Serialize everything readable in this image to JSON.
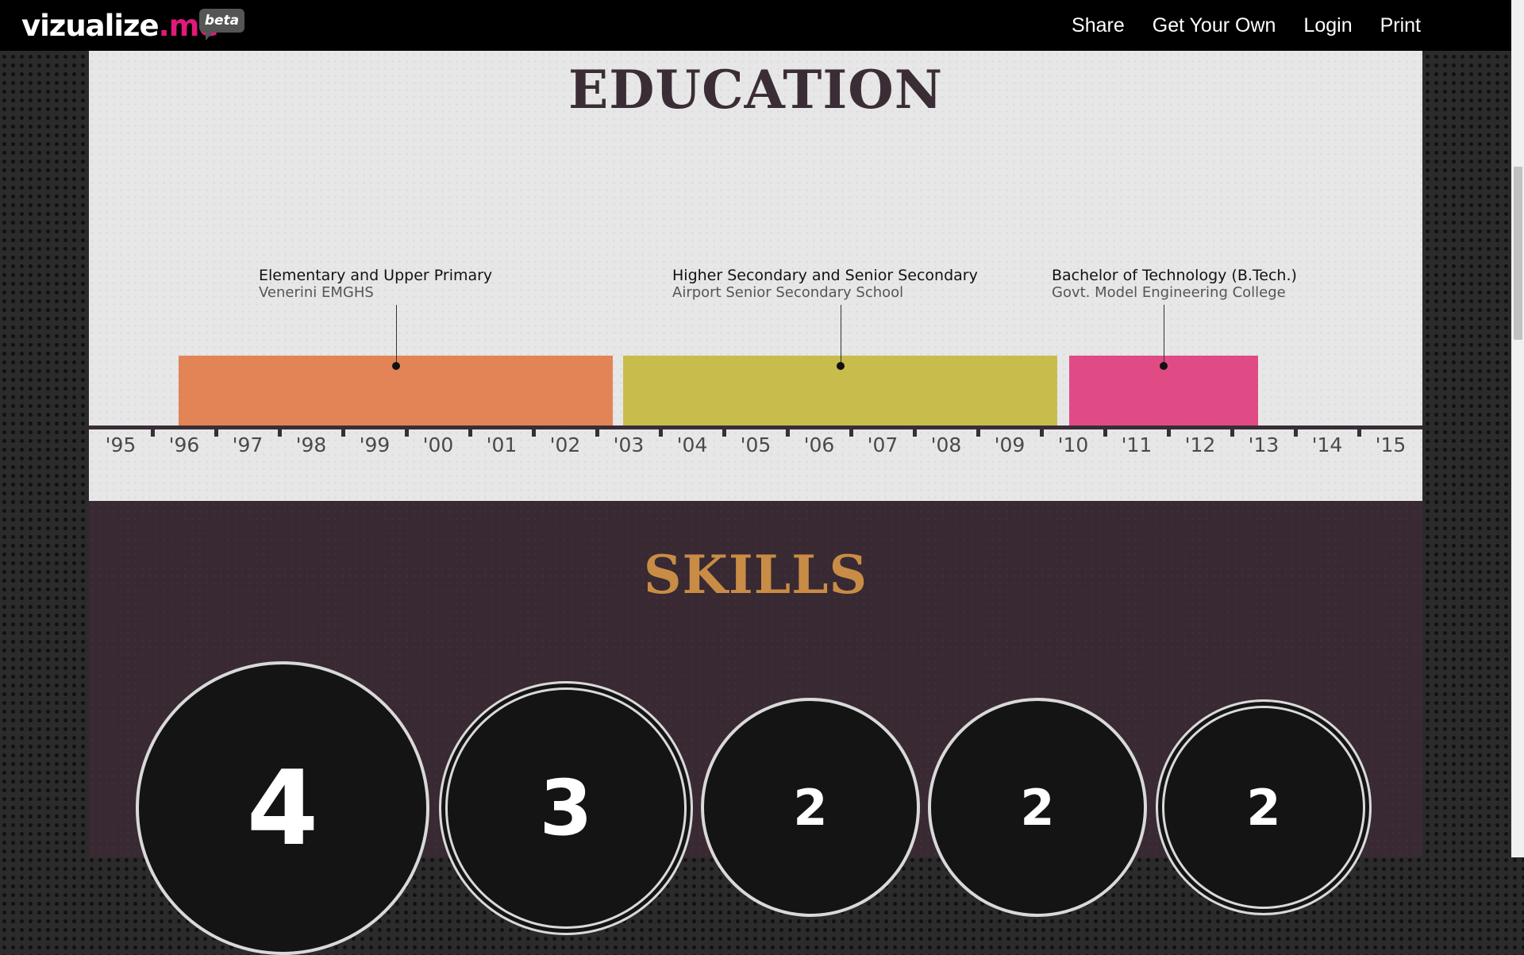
{
  "topbar": {
    "logo_main": "vizualize",
    "logo_accent": ".me",
    "beta": "beta",
    "nav": [
      "Share",
      "Get Your Own",
      "Login",
      "Print"
    ]
  },
  "education": {
    "title": "EDUCATION",
    "years": [
      "'95",
      "'96",
      "'97",
      "'98",
      "'99",
      "'00",
      "'01",
      "'02",
      "'03",
      "'04",
      "'05",
      "'06",
      "'07",
      "'08",
      "'09",
      "'10",
      "'11",
      "'12",
      "'13",
      "'14",
      "'15"
    ],
    "entries": [
      {
        "degree": "Elementary and Upper Primary",
        "institution": "Venerini EMGHS",
        "start": 1996,
        "end": 2003,
        "color": "#e28456"
      },
      {
        "degree": "Higher Secondary and Senior Secondary",
        "institution": "Airport Senior Secondary School",
        "start": 2003,
        "end": 2010,
        "color": "#c8bc4c"
      },
      {
        "degree": "Bachelor of Technology (B.Tech.)",
        "institution": "Govt. Model Engineering College",
        "start": 2010,
        "end": 2014,
        "color": "#e04b86"
      }
    ]
  },
  "skills": {
    "title": "SKILLS",
    "levels": [
      "4",
      "3",
      "2",
      "2",
      "2"
    ]
  },
  "colors": {
    "accent": "#e0197a",
    "skills_title": "#c98c46",
    "edu_bg": "#e8e7e7",
    "skills_bg": "#382932"
  }
}
